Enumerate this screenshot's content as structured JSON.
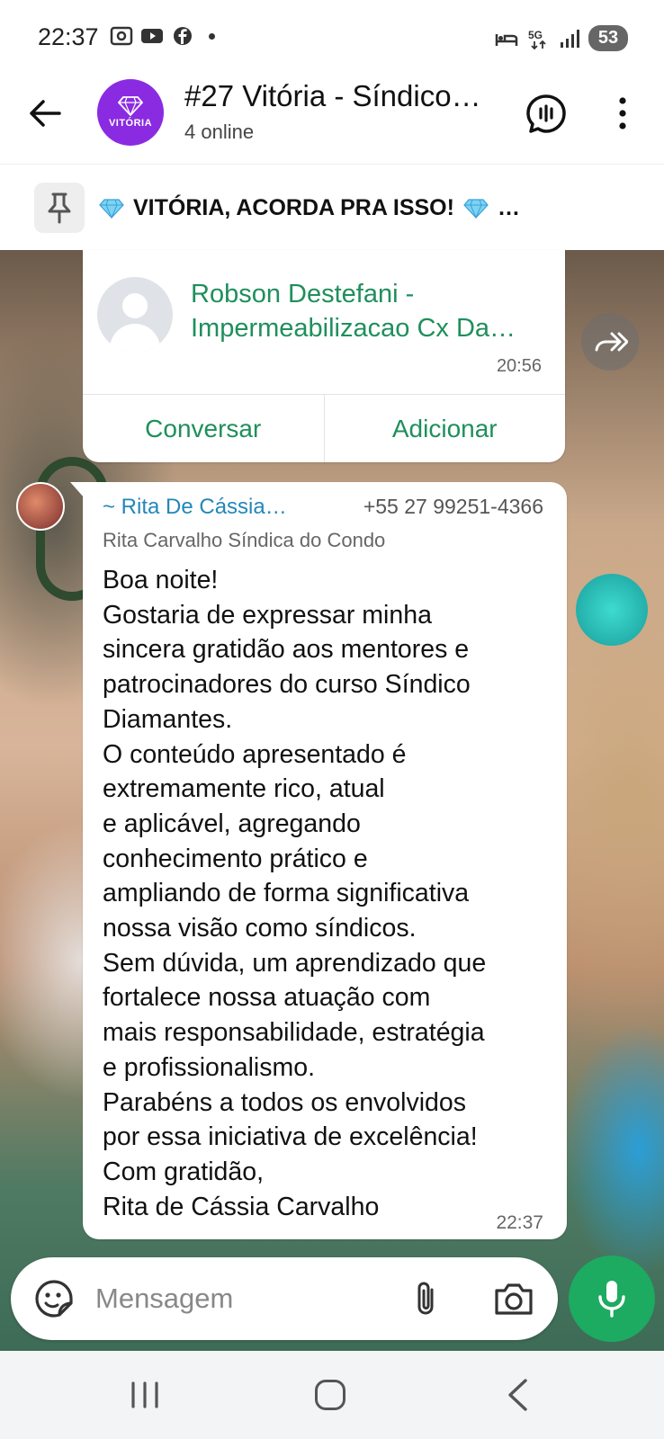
{
  "status_bar": {
    "time": "22:37",
    "network": "5G",
    "battery": "53",
    "icons": [
      "screenshot-icon",
      "youtube-icon",
      "facebook-icon",
      "notification-dot",
      "dnd-bed-icon",
      "5g-icon",
      "signal-icon",
      "battery-icon"
    ]
  },
  "header": {
    "title": "#27 Vitória - Síndico…",
    "subtitle": "4 online",
    "avatar_text": "VITÓRIA",
    "avatar_color": "#8a2be2"
  },
  "pinned": {
    "text": "VITÓRIA, ACORDA PRA ISSO!",
    "suffix": "…"
  },
  "contact_card": {
    "name_line1": "Robson Destefani -",
    "name_line2": "Impermeabilizacao Cx Da…",
    "time": "20:56",
    "action_chat": "Conversar",
    "action_add": "Adicionar",
    "accent_color": "#1f8f5c"
  },
  "message": {
    "sender": "~ Rita De Cássia…",
    "phone": "+55 27 99251-4366",
    "subname": "Rita Carvalho Síndica do Condo",
    "lines": [
      "Boa noite!",
      "Gostaria de expressar minha",
      "sincera gratidão aos mentores e",
      "patrocinadores do curso Síndico",
      "Diamantes.",
      "O conteúdo apresentado é",
      "extremamente rico, atual",
      "e aplicável, agregando",
      "conhecimento prático e",
      "ampliando de forma significativa",
      "nossa visão como síndicos.",
      "Sem dúvida, um aprendizado que",
      "fortalece nossa atuação com",
      "mais responsabilidade, estratégia",
      "e profissionalismo.",
      "Parabéns a todos os envolvidos",
      "por essa iniciativa de excelência!",
      "Com gratidão,",
      "Rita de Cássia Carvalho"
    ],
    "time": "22:37",
    "sender_color": "#2487b8"
  },
  "input": {
    "placeholder": "Mensagem"
  },
  "colors": {
    "mic_button": "#1daa61"
  }
}
